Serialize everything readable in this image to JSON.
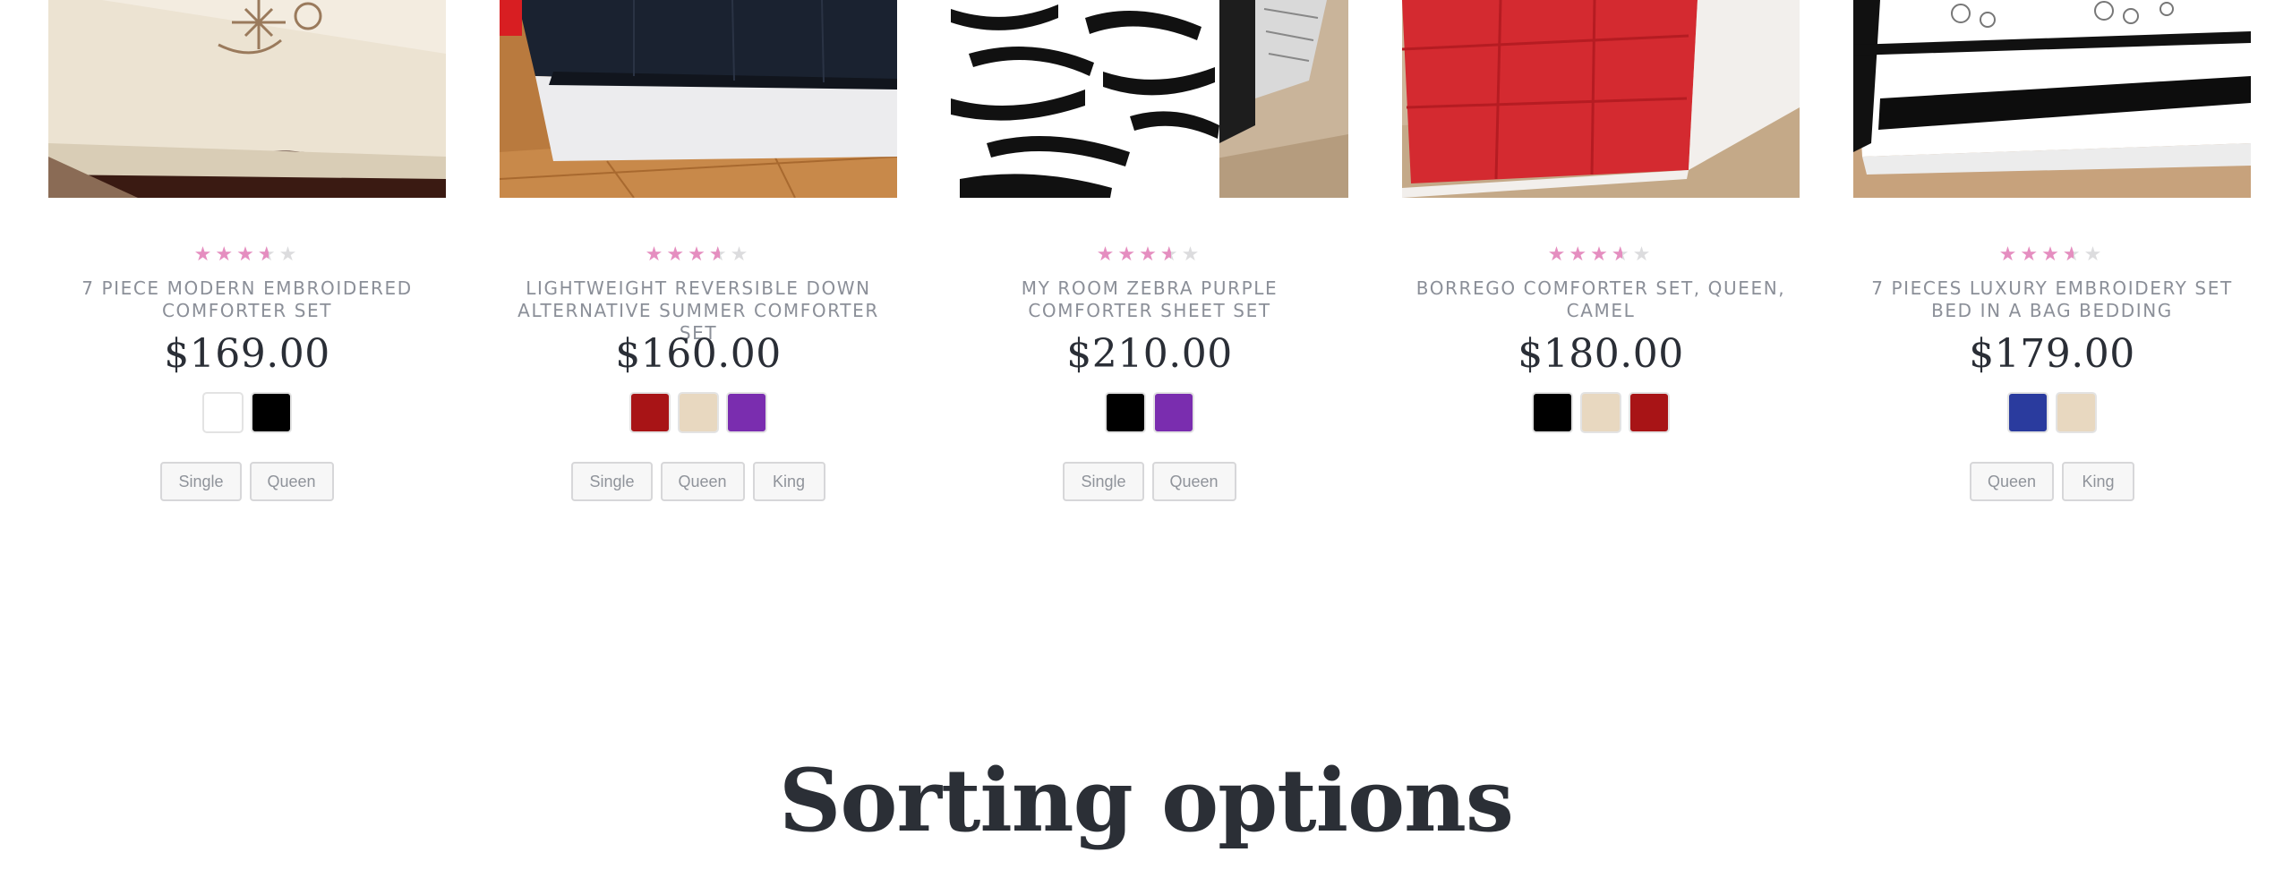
{
  "products": [
    {
      "image": "embroidered-comforter-photo",
      "rating": 3.5,
      "title": "7 PIECE MODERN EMBROIDERED COMFORTER SET",
      "price": "$169.00",
      "swatches": [
        "#ffffff",
        "#000000"
      ],
      "sizes": [
        "Single",
        "Queen"
      ]
    },
    {
      "image": "navy-comforter-photo",
      "rating": 3.5,
      "title": "LIGHTWEIGHT REVERSIBLE DOWN ALTERNATIVE SUMMER COMFORTER SET",
      "price": "$160.00",
      "swatches": [
        "#a81416",
        "#e8d8c0",
        "#7a2daf"
      ],
      "sizes": [
        "Single",
        "Queen",
        "King"
      ]
    },
    {
      "image": "zebra-comforter-photo",
      "rating": 3.5,
      "title": "MY ROOM ZEBRA PURPLE COMFORTER SHEET SET",
      "price": "$210.00",
      "swatches": [
        "#000000",
        "#7a2daf"
      ],
      "sizes": [
        "Single",
        "Queen"
      ]
    },
    {
      "image": "red-comforter-photo",
      "rating": 3.5,
      "title": "BORREGO COMFORTER SET, QUEEN, CAMEL",
      "price": "$180.00",
      "swatches": [
        "#000000",
        "#e8d8c0",
        "#a81416"
      ],
      "sizes": []
    },
    {
      "image": "luxury-embroidery-photo",
      "rating": 3.5,
      "title": "7 PIECES LUXURY EMBROIDERY SET BED IN A BAG BEDDING",
      "price": "$179.00",
      "swatches": [
        "#2a3b9e",
        "#e8d8c0"
      ],
      "sizes": [
        "Queen",
        "King"
      ]
    }
  ],
  "section": {
    "heading": "Sorting options"
  },
  "colors": {
    "star_active": "#e58ec0",
    "star_inactive": "#dcdcde",
    "title_text": "#8b8f98",
    "price_text": "#2a2e36"
  }
}
